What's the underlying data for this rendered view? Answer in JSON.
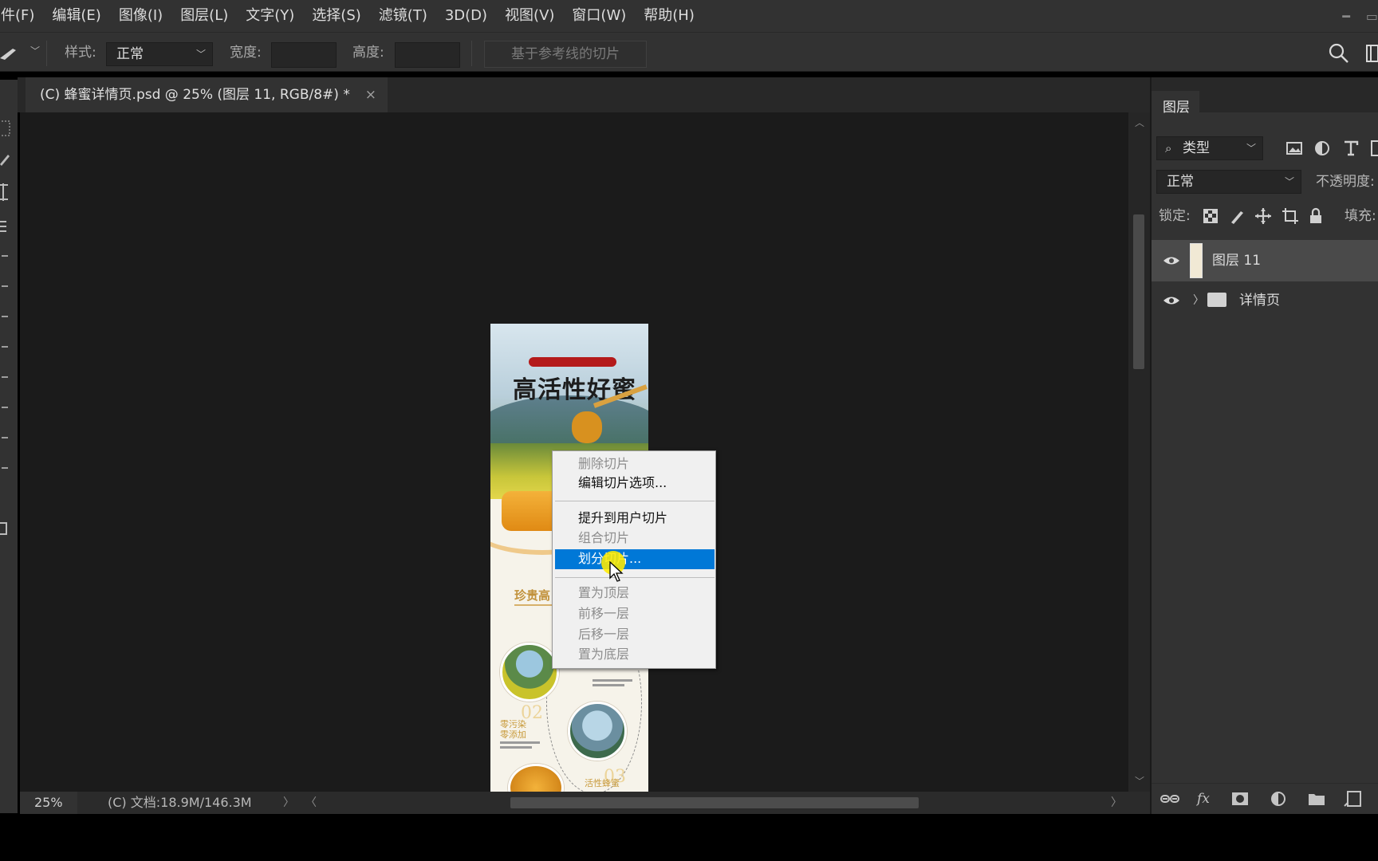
{
  "menu": [
    "件(F)",
    "编辑(E)",
    "图像(I)",
    "图层(L)",
    "文字(Y)",
    "选择(S)",
    "滤镜(T)",
    "3D(D)",
    "视图(V)",
    "窗口(W)",
    "帮助(H)"
  ],
  "options": {
    "style_label": "样式:",
    "style_value": "正常",
    "width_label": "宽度:",
    "height_label": "高度:",
    "guides_button": "基于参考线的切片"
  },
  "document": {
    "tab_title": "(C) 蜂蜜详情页.psd @ 25% (图层 11, RGB/8#) *",
    "close": "×",
    "poster_title": "高活性好蜜",
    "section_title": "珍贵高",
    "num_02": "02",
    "num_03": "03",
    "caption_1": "零污染\n零添加",
    "caption_2": "活性蜂蜜"
  },
  "context_menu": {
    "items": [
      {
        "label": "删除切片",
        "enabled": false
      },
      {
        "label": "编辑切片选项...",
        "enabled": true
      },
      {
        "label": "提升到用户切片",
        "enabled": true
      },
      {
        "label": "组合切片",
        "enabled": false
      },
      {
        "label": "划分切片...",
        "enabled": true,
        "highlighted": true
      },
      {
        "label": "置为顶层",
        "enabled": false
      },
      {
        "label": "前移一层",
        "enabled": false
      },
      {
        "label": "后移一层",
        "enabled": false
      },
      {
        "label": "置为底层",
        "enabled": false
      }
    ]
  },
  "status": {
    "zoom": "25%",
    "doc_info": "(C) 文档:18.9M/146.3M"
  },
  "layers_panel": {
    "tab": "图层",
    "filter_kind": "类型",
    "blend_mode": "正常",
    "opacity_label": "不透明度:",
    "lock_label": "锁定:",
    "fill_label": "填充:",
    "layers": [
      {
        "name": "图层 11",
        "selected": true,
        "visible": true,
        "type": "pixel"
      },
      {
        "name": "详情页",
        "selected": false,
        "visible": true,
        "type": "group"
      }
    ]
  },
  "colors": {
    "highlight": "#0078d7",
    "panel_bg": "#323232",
    "canvas_bg": "#1b1b1b",
    "cursor_highlight": "#ffeb00"
  }
}
